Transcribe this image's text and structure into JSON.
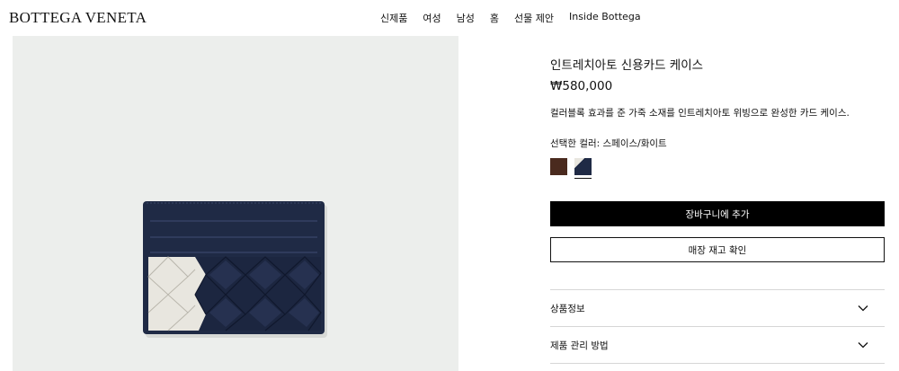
{
  "brand": {
    "name": "BOTTEGA VENETA"
  },
  "nav": {
    "items": [
      {
        "label": "신제품"
      },
      {
        "label": "여성"
      },
      {
        "label": "남성"
      },
      {
        "label": "홈"
      },
      {
        "label": "선물 제안"
      },
      {
        "label": "Inside Bottega"
      }
    ]
  },
  "product": {
    "title": "인트레치아토 신용카드 케이스",
    "price": "₩580,000",
    "description": "컬러블록 효과를 준 가죽 소재를 인트레치아토 위빙으로 완성한 카드 케이스.",
    "selected_color_label": "선택한 컬러: 스페이스/화이트",
    "swatches": [
      {
        "color": "#4a2a1e",
        "selected": false
      },
      {
        "color": "#1f2a45",
        "selected": true
      }
    ]
  },
  "actions": {
    "add_to_bag": "장바구니에 추가",
    "check_store": "매장 재고 확인"
  },
  "accordion": [
    {
      "label": "상품정보"
    },
    {
      "label": "제품 관리 방법"
    }
  ],
  "colors": {
    "accent": "#000000",
    "image_bg": "#eceeec",
    "leather_navy": "#1f2a45",
    "leather_white": "#e8e6df"
  }
}
